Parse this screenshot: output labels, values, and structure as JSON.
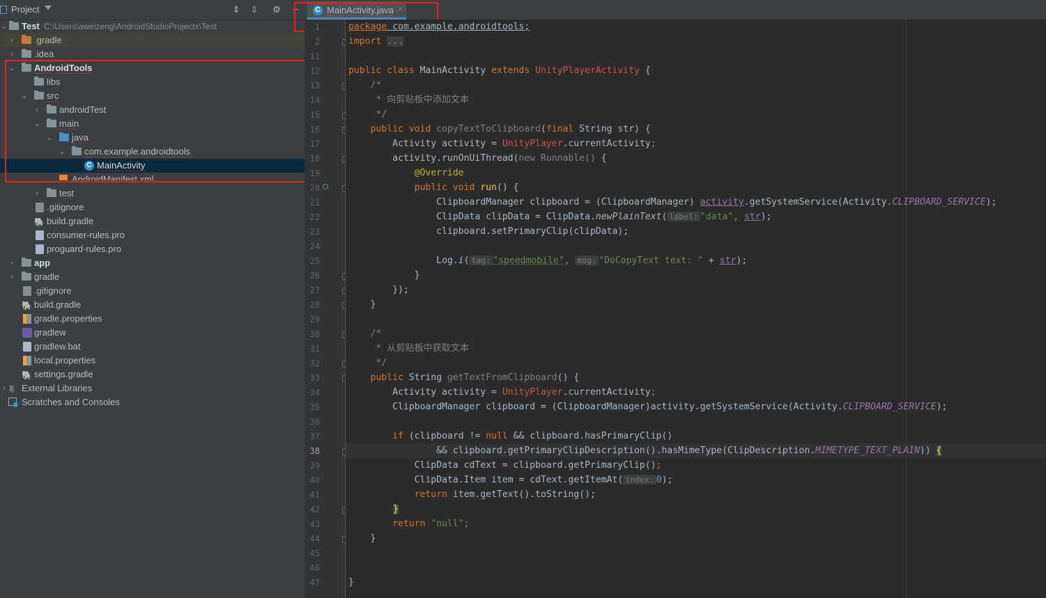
{
  "project_panel": {
    "title": "Project",
    "tree": [
      {
        "label": "Test",
        "path": "C:\\Users\\aweizeng\\AndroidStudioProjects\\Test"
      },
      {
        "label": ".gradle"
      },
      {
        "label": ".idea"
      },
      {
        "label": "AndroidTools"
      },
      {
        "label": "libs"
      },
      {
        "label": "src"
      },
      {
        "label": "androidTest"
      },
      {
        "label": "main"
      },
      {
        "label": "java"
      },
      {
        "label": "com.example.androidtools"
      },
      {
        "label": "MainActivity"
      },
      {
        "label": "AndroidManifest.xml"
      },
      {
        "label": "test"
      },
      {
        "label": ".gitignore"
      },
      {
        "label": "build.gradle"
      },
      {
        "label": "consumer-rules.pro"
      },
      {
        "label": "proguard-rules.pro"
      },
      {
        "label": "app"
      },
      {
        "label": "gradle"
      },
      {
        "label": ".gitignore"
      },
      {
        "label": "build.gradle"
      },
      {
        "label": "gradle.properties"
      },
      {
        "label": "gradlew"
      },
      {
        "label": "gradlew.bat"
      },
      {
        "label": "local.properties"
      },
      {
        "label": "settings.gradle"
      },
      {
        "label": "External Libraries"
      },
      {
        "label": "Scratches and Consoles"
      }
    ]
  },
  "editor": {
    "tab_label": "MainActivity.java",
    "tab_close": "×",
    "line_numbers": [
      "1",
      "2",
      "11",
      "12",
      "13",
      "14",
      "15",
      "16",
      "17",
      "18",
      "19",
      "20",
      "21",
      "22",
      "23",
      "24",
      "25",
      "26",
      "27",
      "28",
      "29",
      "30",
      "31",
      "32",
      "33",
      "34",
      "35",
      "36",
      "37",
      "38",
      "39",
      "40",
      "41",
      "42",
      "43",
      "44",
      "45",
      "46",
      "47"
    ],
    "current_line": "38",
    "code": {
      "l1_pkg": "package",
      "l1_name": " com.example.androidtools;",
      "l2_import": "import ",
      "l2_dots": "...",
      "l12_a": "public class ",
      "l12_cls": "MainActivity ",
      "l12_ext": "extends ",
      "l12_base": "UnityPlayerActivity",
      "l12_b": " {",
      "l13": "    /*",
      "l14": "     * 向剪贴板中添加文本",
      "l15": "     */",
      "l16_a": "    public void ",
      "l16_fn": "copyTextToClipboard",
      "l16_b": "(",
      "l16_final": "final ",
      "l16_c": "String str) {",
      "l17_a": "        Activity activity = ",
      "l17_u": "UnityPlayer",
      "l17_b": ".currentActivity",
      "l17_c": ";",
      "l18_a": "        activity.runOnUiThread(",
      "l18_new": "new Runnable()",
      "l18_b": " {",
      "l19": "            @Override",
      "l20_a": "            public void ",
      "l20_fn": "run",
      "l20_b": "() {",
      "l21_a": "                ClipboardManager clipboard = (ClipboardManager) ",
      "l21_act": "activity",
      "l21_b": ".getSystemService(Activity.",
      "l21_fld": "CLIPBOARD_SERVICE",
      "l21_c": ");",
      "l22_a": "                ClipData clipData = ClipData.",
      "l22_fn": "newPlainText",
      "l22_b": "(",
      "l22_hint": "label:",
      "l22_s": "\"data\"",
      "l22_c": ", ",
      "l22_str": "str",
      "l22_d": ");",
      "l23": "                clipboard.setPrimaryClip(clipData);",
      "l25_a": "                Log.",
      "l25_fn": "i",
      "l25_b": "(",
      "l25_hint1": "tag:",
      "l25_s1": "\"speedmobile\"",
      "l25_c": ", ",
      "l25_hint2": "msg:",
      "l25_s2": "\"DoCopyText text: \"",
      "l25_d": " + ",
      "l25_str": "str",
      "l25_e": ");",
      "l26": "            }",
      "l27": "        });",
      "l28": "    }",
      "l30": "    /*",
      "l31": "     * 从剪贴板中获取文本",
      "l32": "     */",
      "l33_a": "    public ",
      "l33_b": "String ",
      "l33_fn": "getTextFromClipboard",
      "l33_c": "() {",
      "l34_a": "        Activity activity = ",
      "l34_u": "UnityPlayer",
      "l34_b": ".currentActivity",
      "l34_c": ";",
      "l35_a": "        ClipboardManager clipboard = (ClipboardManager)activity.getSystemService(Activity.",
      "l35_fld": "CLIPBOARD_SERVICE",
      "l35_b": ");",
      "l37_a": "        ",
      "l37_if": "if",
      "l37_b": " (clipboard != ",
      "l37_null": "null",
      "l37_c": " && clipboard.hasPrimaryClip()",
      "l38_a": "                && clipboard.getPrimaryClipDescription().hasMimeType(ClipDescription.",
      "l38_fld": "MIMETYPE_TEXT_PLAIN",
      "l38_b": ")) ",
      "l38_brace": "{",
      "l39_a": "            ClipData cdText = clipboard.getPrimaryClip()",
      "l39_b": ";",
      "l40_a": "            ClipData.Item item = cdText.getItemAt(",
      "l40_hint": "index:",
      "l40_num": "0",
      "l40_b": ");",
      "l41_a": "            ",
      "l41_ret": "return",
      "l41_b": " item.getText().toString();",
      "l42_brace": "}",
      "l43_a": "        ",
      "l43_ret": "return ",
      "l43_s": "\"null\"",
      "l43_b": ";",
      "l44": "    }",
      "l47": "}"
    }
  },
  "colors": {
    "keyword": "#cc7832",
    "string": "#6a8759",
    "comment": "#808080",
    "annotation": "#bbb529",
    "constant": "#9876aa",
    "error_class": "#c75450",
    "highlight_box": "#e8231d",
    "selection": "#0d293e"
  }
}
